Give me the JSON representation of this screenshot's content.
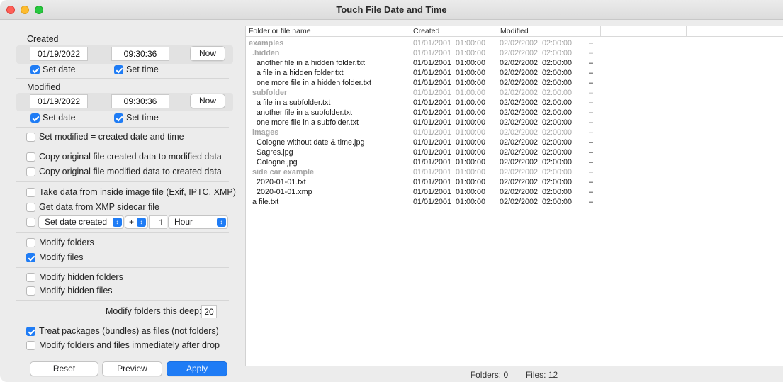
{
  "window": {
    "title": "Touch File Date and Time"
  },
  "created": {
    "heading": "Created",
    "date": "01/19/2022",
    "time": "09:30:36",
    "now_label": "Now",
    "set_date_label": "Set date",
    "set_time_label": "Set time",
    "set_date_checked": true,
    "set_time_checked": true
  },
  "modified": {
    "heading": "Modified",
    "date": "01/19/2022",
    "time": "09:30:36",
    "now_label": "Now",
    "set_date_label": "Set date",
    "set_time_label": "Set time",
    "set_date_checked": true,
    "set_time_checked": true
  },
  "options": {
    "set_mod_eq_created": "Set modified = created date and time",
    "copy_created_to_modified": "Copy original file created data to modified data",
    "copy_modified_to_created": "Copy original file modified data to created data",
    "take_from_image": "Take data from inside image file (Exif, IPTC, XMP)",
    "get_from_xmp": "Get data from XMP sidecar file",
    "set_date_popup": "Set date created",
    "sign_popup": "+",
    "amount": "1",
    "unit_popup": "Hour",
    "modify_folders": "Modify folders",
    "modify_files": "Modify files",
    "modify_hidden_folders": "Modify hidden folders",
    "modify_hidden_files": "Modify hidden files",
    "depth_label": "Modify folders this deep:",
    "depth_value": "20",
    "treat_packages": "Treat packages (bundles) as files (not folders)",
    "modify_immediately": "Modify folders and files immediately after drop"
  },
  "buttons": {
    "reset": "Reset",
    "preview": "Preview",
    "apply": "Apply"
  },
  "table": {
    "headers": [
      "Folder or file name",
      "Created",
      "Modified"
    ],
    "rows": [
      {
        "name": "examples",
        "created": "01/01/2001  01:00:00",
        "modified": "02/02/2002  02:00:00",
        "dash": "–",
        "style": "grey",
        "indent": 0
      },
      {
        "name": ".hidden",
        "created": "01/01/2001  01:00:00",
        "modified": "02/02/2002  02:00:00",
        "dash": "–",
        "style": "grey",
        "indent": 1
      },
      {
        "name": "another file in a hidden folder.txt",
        "created": "01/01/2001  01:00:00",
        "modified": "02/02/2002  02:00:00",
        "dash": "–",
        "style": "black",
        "indent": 2
      },
      {
        "name": "a file in a hidden folder.txt",
        "created": "01/01/2001  01:00:00",
        "modified": "02/02/2002  02:00:00",
        "dash": "–",
        "style": "black",
        "indent": 2
      },
      {
        "name": "one more file in a hidden folder.txt",
        "created": "01/01/2001  01:00:00",
        "modified": "02/02/2002  02:00:00",
        "dash": "–",
        "style": "black",
        "indent": 2
      },
      {
        "name": "subfolder",
        "created": "01/01/2001  01:00:00",
        "modified": "02/02/2002  02:00:00",
        "dash": "–",
        "style": "grey",
        "indent": 1
      },
      {
        "name": "a file in a subfolder.txt",
        "created": "01/01/2001  01:00:00",
        "modified": "02/02/2002  02:00:00",
        "dash": "–",
        "style": "black",
        "indent": 2
      },
      {
        "name": "another file in a subfolder.txt",
        "created": "01/01/2001  01:00:00",
        "modified": "02/02/2002  02:00:00",
        "dash": "–",
        "style": "black",
        "indent": 2
      },
      {
        "name": "one more file in a subfolder.txt",
        "created": "01/01/2001  01:00:00",
        "modified": "02/02/2002  02:00:00",
        "dash": "–",
        "style": "black",
        "indent": 2
      },
      {
        "name": "images",
        "created": "01/01/2001  01:00:00",
        "modified": "02/02/2002  02:00:00",
        "dash": "–",
        "style": "grey",
        "indent": 1
      },
      {
        "name": "Cologne without date & time.jpg",
        "created": "01/01/2001  01:00:00",
        "modified": "02/02/2002  02:00:00",
        "dash": "–",
        "style": "black",
        "indent": 2
      },
      {
        "name": "Sagres.jpg",
        "created": "01/01/2001  01:00:00",
        "modified": "02/02/2002  02:00:00",
        "dash": "–",
        "style": "black",
        "indent": 2
      },
      {
        "name": "Cologne.jpg",
        "created": "01/01/2001  01:00:00",
        "modified": "02/02/2002  02:00:00",
        "dash": "–",
        "style": "black",
        "indent": 2
      },
      {
        "name": "side car example",
        "created": "01/01/2001  01:00:00",
        "modified": "02/02/2002  02:00:00",
        "dash": "–",
        "style": "grey",
        "indent": 1
      },
      {
        "name": "2020-01-01.txt",
        "created": "01/01/2001  01:00:00",
        "modified": "02/02/2002  02:00:00",
        "dash": "–",
        "style": "black",
        "indent": 2
      },
      {
        "name": "2020-01-01.xmp",
        "created": "01/01/2001  01:00:00",
        "modified": "02/02/2002  02:00:00",
        "dash": "–",
        "style": "black",
        "indent": 2
      },
      {
        "name": "a file.txt",
        "created": "01/01/2001  01:00:00",
        "modified": "02/02/2002  02:00:00",
        "dash": "–",
        "style": "black",
        "indent": 1
      }
    ]
  },
  "status": {
    "folders": "Folders:  0",
    "files": "Files: 12"
  },
  "colors": {
    "accent": "#1f7cf5",
    "close": "#ff5f57",
    "minimize": "#febc2e",
    "maximize": "#28c840"
  },
  "icons": [
    "close-window-icon",
    "minimize-window-icon",
    "maximize-window-icon",
    "checkmark-icon",
    "stepper-icon"
  ]
}
